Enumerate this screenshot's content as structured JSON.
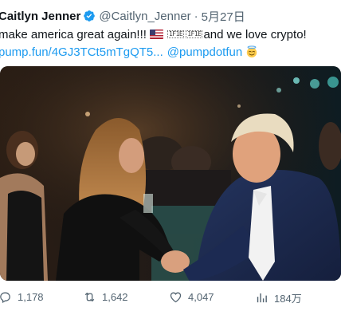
{
  "tweet": {
    "display_name": "Caitlyn Jenner",
    "handle": "@Caitlyn_Jenner",
    "separator": "·",
    "date": "5月27日",
    "text_part1": "make america great again!!!",
    "text_glyphs_1": "1F1E",
    "text_glyphs_2": "1F1E",
    "text_part2": "and we love crypto!",
    "link": "pump.fun/4GJ3TCt5mTgQT5...",
    "mention": "@pumpdotfun",
    "emoji_icon": "smiling-face-with-halo-icon",
    "flag_icon": "us-flag-icon",
    "verified_icon": "verified-badge-icon"
  },
  "photo": {
    "description_icon": "photo-handshake"
  },
  "metrics": {
    "replies": "1,178",
    "retweets": "1,642",
    "likes": "4,047",
    "views": "184万"
  },
  "colors": {
    "link": "#1d9bf0",
    "secondary_text": "#536471",
    "verified": "#1d9bf0"
  }
}
